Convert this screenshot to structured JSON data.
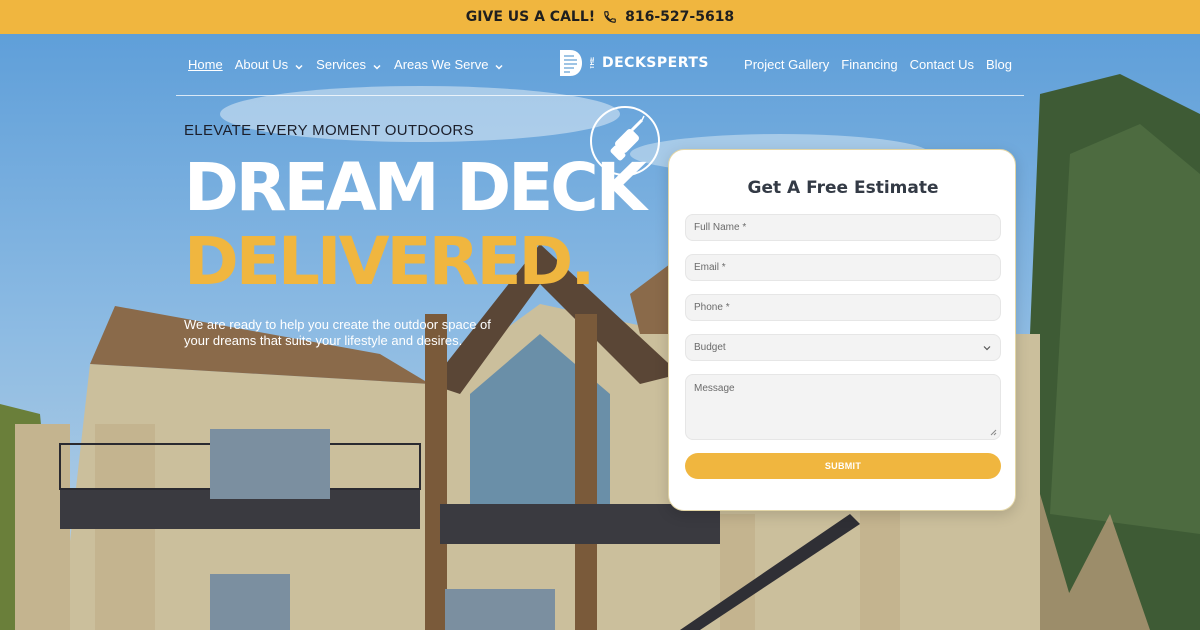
{
  "topbar": {
    "cta": "GIVE US A CALL!",
    "phone": "816-527-5618",
    "phone_icon": "phone-icon",
    "bg_color": "#f0b63f"
  },
  "nav": {
    "left": [
      {
        "label": "Home",
        "active": true
      },
      {
        "label": "About Us",
        "dropdown": true
      },
      {
        "label": "Services",
        "dropdown": true
      },
      {
        "label": "Areas We Serve",
        "dropdown": true
      }
    ],
    "logo": {
      "prefix": "THE",
      "name": "DECKSPERTS"
    },
    "right": [
      {
        "label": "Project Gallery"
      },
      {
        "label": "Financing"
      },
      {
        "label": "Contact Us"
      },
      {
        "label": "Blog"
      }
    ]
  },
  "hero": {
    "eyebrow": "ELEVATE EVERY MOMENT OUTDOORS",
    "headline_line1": "DREAM DECK",
    "headline_line2": "DELIVERED.",
    "subtext": "We are ready to help you create the outdoor space of your dreams that suits your lifestyle and desires.",
    "badge_icon": "drill-icon",
    "accent_color": "#f0b63f"
  },
  "form": {
    "title": "Get A Free Estimate",
    "fields": {
      "full_name": "Full Name *",
      "email": "Email *",
      "phone": "Phone *",
      "budget": "Budget",
      "message": "Message"
    },
    "submit_label": "SUBMIT"
  }
}
